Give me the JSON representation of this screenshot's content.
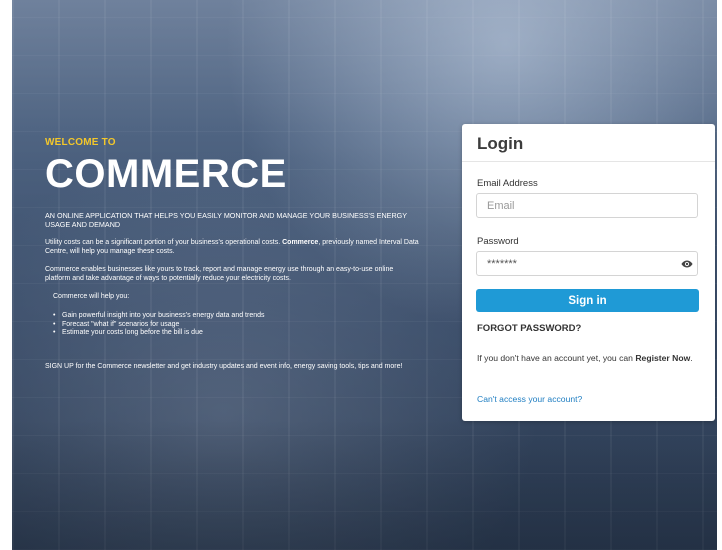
{
  "colors": {
    "accent_yellow": "#f3c72b",
    "primary_blue": "#1f9ad6",
    "link_blue": "#1f7ec2"
  },
  "hero": {
    "welcome": "WELCOME TO",
    "brand": "COMMERCE",
    "tagline": "AN ONLINE APPLICATION THAT HELPS YOU EASILY MONITOR AND MANAGE YOUR BUSINESS'S ENERGY USAGE AND DEMAND",
    "para1_start": "Utility costs can be a significant portion of your business's operational costs. ",
    "para1_bold": "Commerce",
    "para1_end": ", previously named Interval Data Centre, will help you manage these costs.",
    "para2": "Commerce enables businesses like yours to track, report and manage energy use through an easy-to-use online platform and take advantage of ways to potentially reduce your electricity costs.",
    "helps": "Commerce will help you:",
    "benefits": [
      "Gain powerful insight into your business's energy data and trends",
      "Forecast \"what if\" scenarios for usage",
      "Estimate your costs long before the bill is due"
    ],
    "signup": "SIGN UP for the Commerce newsletter and get industry updates and event info, energy saving tools, tips and more!"
  },
  "login": {
    "title": "Login",
    "email_label": "Email Address",
    "email_placeholder": "Email",
    "password_label": "Password",
    "password_value": "*******",
    "eye_icon": "eye-icon",
    "signin_label": "Sign in",
    "forgot_label": "FORGOT PASSWORD?",
    "register_prefix": "If you don't have an account yet, you can ",
    "register_link": "Register Now",
    "register_suffix": ".",
    "cant_access": "Can't access your account?"
  }
}
